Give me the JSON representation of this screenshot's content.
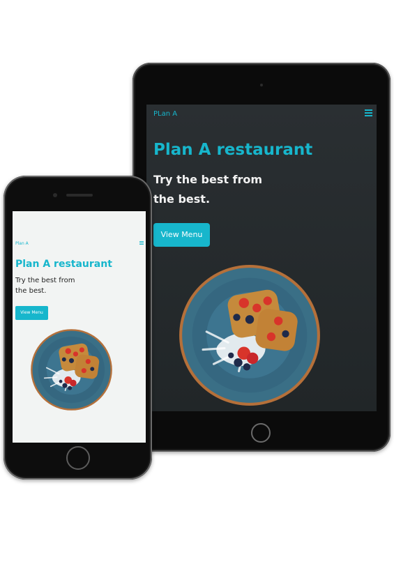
{
  "tablet": {
    "brand": "PLan A",
    "title": "Plan A restaurant",
    "subtitle_line1": "Try the best from",
    "subtitle_line2": "the best.",
    "button_label": "View Menu"
  },
  "phone": {
    "brand": "Plan A",
    "title": "Plan A restaurant",
    "subtitle_line1": "Try the best from",
    "subtitle_line2": "the best.",
    "button_label": "View Menu"
  },
  "icons": {
    "menu": "hamburger-menu-icon",
    "hero": "food-plate-image"
  },
  "colors": {
    "accent": "#17b6cc",
    "tablet_bg": "#262b2d",
    "phone_bg": "#f2f4f3",
    "plate": "#3a6f86",
    "plate_rim": "#b5703a",
    "toast": "#c58a3c",
    "strawberry": "#d8342a",
    "blueberry": "#1f2a4a"
  }
}
